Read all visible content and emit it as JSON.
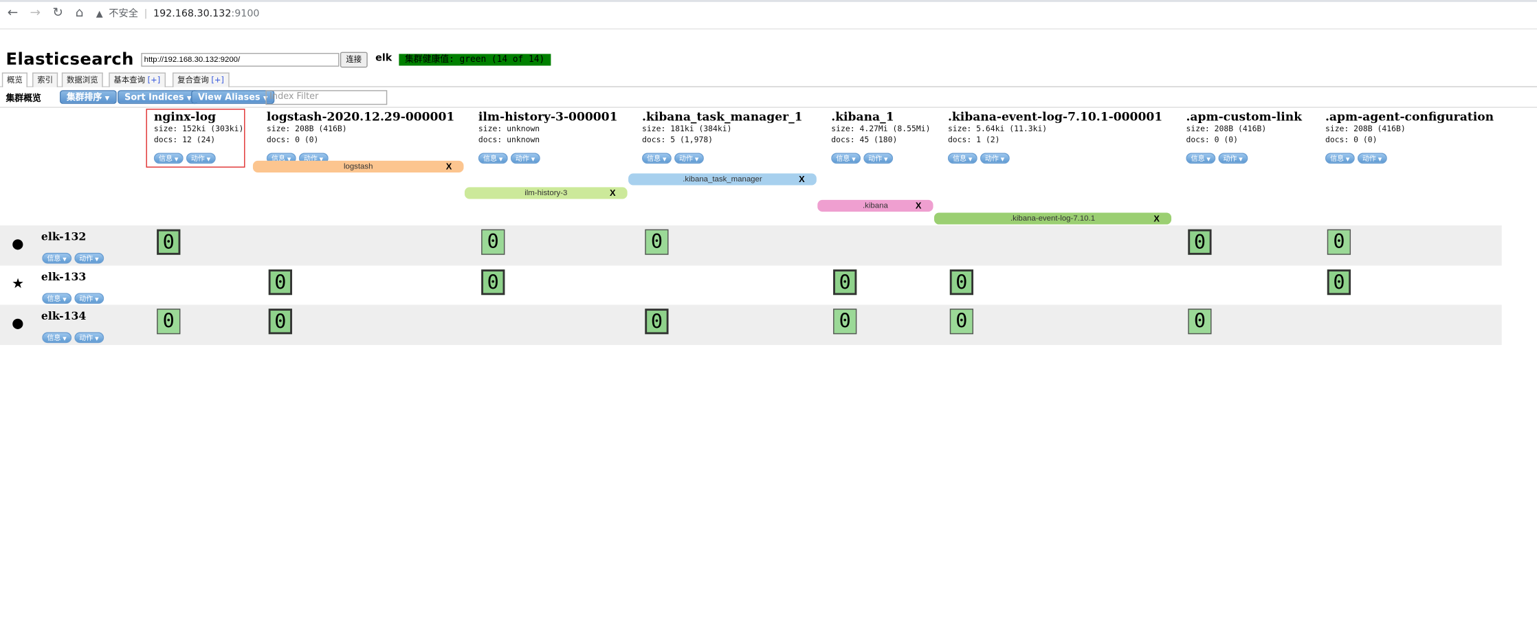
{
  "browser": {
    "back": "←",
    "forward": "→",
    "reload": "↻",
    "home": "⌂",
    "warning_icon": "▲",
    "insecure_label": "不安全",
    "separator": "|",
    "host": "192.168.30.132",
    "port": ":9100"
  },
  "header": {
    "brand": "Elasticsearch",
    "connect_url": "http://192.168.30.132:9200/",
    "connect_label": "连接",
    "cluster_name": "elk",
    "health": "集群健康值: green (14 of 14)",
    "health_color": "#008000"
  },
  "tabs": [
    {
      "label": "概览",
      "plus": ""
    },
    {
      "label": "索引",
      "plus": ""
    },
    {
      "label": "数据浏览",
      "plus": ""
    },
    {
      "label": "基本查询",
      "plus": "[+]"
    },
    {
      "label": "复合查询",
      "plus": "[+]"
    }
  ],
  "toolbar": {
    "title": "集群概览",
    "sort_cluster": "集群排序",
    "sort_indices": "Sort Indices",
    "view_aliases": "View Aliases",
    "filter_placeholder": "Index Filter"
  },
  "pill_labels": {
    "info": "信息",
    "action": "动作"
  },
  "indices": [
    {
      "name": "nginx-log",
      "size": "size: 152ki (303ki)",
      "docs": "docs: 12 (24)"
    },
    {
      "name": "logstash-2020.12.29-000001",
      "size": "size: 208B (416B)",
      "docs": "docs: 0 (0)"
    },
    {
      "name": "ilm-history-3-000001",
      "size": "size: unknown",
      "docs": "docs: unknown"
    },
    {
      "name": ".kibana_task_manager_1",
      "size": "size: 181ki (384ki)",
      "docs": "docs: 5 (1,978)"
    },
    {
      "name": ".kibana_1",
      "size": "size: 4.27Mi (8.55Mi)",
      "docs": "docs: 45 (180)"
    },
    {
      "name": ".kibana-event-log-7.10.1-000001",
      "size": "size: 5.64ki (11.3ki)",
      "docs": "docs: 1 (2)"
    },
    {
      "name": ".apm-custom-link",
      "size": "size: 208B (416B)",
      "docs": "docs: 0 (0)"
    },
    {
      "name": ".apm-agent-configuration",
      "size": "size: 208B (416B)",
      "docs": "docs: 0 (0)"
    }
  ],
  "aliases": [
    {
      "name": "logstash",
      "close": "X",
      "color": "#fcc58f"
    },
    {
      "name": "ilm-history-3",
      "close": "X",
      "color": "#cce99a"
    },
    {
      "name": ".kibana_task_manager",
      "close": "X",
      "color": "#a7d0ee"
    },
    {
      "name": ".kibana",
      "close": "X",
      "color": "#ef9fd0"
    },
    {
      "name": ".kibana-event-log-7.10.1",
      "close": "X",
      "color": "#9bcf72"
    }
  ],
  "nodes": [
    {
      "name": "elk-132",
      "icon": "●",
      "master": false
    },
    {
      "name": "elk-133",
      "icon": "★",
      "master": true
    },
    {
      "name": "elk-134",
      "icon": "●",
      "master": false
    }
  ],
  "shard_label": "0"
}
